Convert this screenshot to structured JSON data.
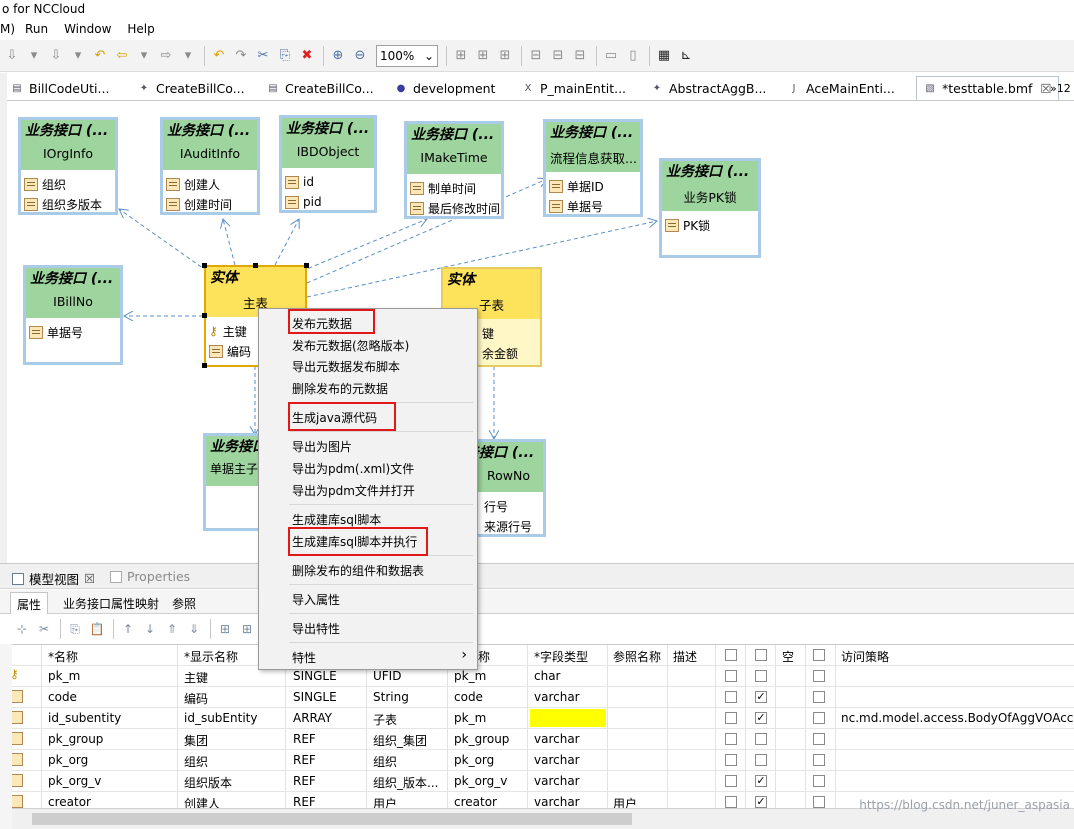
{
  "window": {
    "title": "o for NCCloud"
  },
  "menu": [
    "M)",
    "Run",
    "Window",
    "Help"
  ],
  "toolbar": {
    "zoom": "100%"
  },
  "editor_tabs": [
    {
      "label": "BillCodeUti..."
    },
    {
      "label": "CreateBillCo..."
    },
    {
      "label": "CreateBillCo..."
    },
    {
      "label": "development"
    },
    {
      "label": "P_mainEntit..."
    },
    {
      "label": "AbstractAggB..."
    },
    {
      "label": "AceMainEnti..."
    },
    {
      "label": "*testtable.bmf"
    },
    {
      "label": "»12"
    }
  ],
  "diagram": {
    "stereotype": "业务接口 (...",
    "entity_stereotype": "实体",
    "nodes": {
      "iorginfo": {
        "name": "IOrgInfo",
        "attrs": [
          "组织",
          "组织多版本"
        ]
      },
      "iauditinfo": {
        "name": "IAuditInfo",
        "attrs": [
          "创建人",
          "创建时间"
        ]
      },
      "ibdobject": {
        "name": "IBDObject",
        "attrs": [
          "id",
          "pid"
        ]
      },
      "imaketime": {
        "name": "IMakeTime",
        "attrs": [
          "制单时间",
          "最后修改时间"
        ]
      },
      "flowinfo": {
        "name": "流程信息获取...",
        "attrs": [
          "单据ID",
          "单据号"
        ]
      },
      "pklock": {
        "name": "业务PK锁",
        "attrs": [
          "PK锁"
        ]
      },
      "ibillno": {
        "name": "IBillNo",
        "attrs": [
          "单据号"
        ]
      },
      "main": {
        "name": "主表",
        "attrs": [
          "主键",
          "编码"
        ]
      },
      "child": {
        "name": "子表",
        "attrs": [
          "键",
          "余金额"
        ]
      },
      "billmain": {
        "name": "单据主子"
      },
      "rowno": {
        "name": "RowNo",
        "attrs": [
          "行号",
          "来源行号"
        ]
      }
    }
  },
  "context_menu": {
    "items": [
      "发布元数据",
      "发布元数据(忽略版本)",
      "导出元数据发布脚本",
      "删除发布的元数据",
      "生成java源代码",
      "导出为图片",
      "导出为pdm(.xml)文件",
      "导出为pdm文件并打开",
      "生成建库sql脚本",
      "生成建库sql脚本并执行",
      "删除发布的组件和数据表",
      "导入属性",
      "导出特性",
      "特性"
    ],
    "submenu_arrow": "›"
  },
  "bottom_panel": {
    "tabs": [
      "模型视图",
      "Properties"
    ],
    "subtabs": [
      "属性",
      "业务接口属性映射",
      "参照"
    ]
  },
  "grid": {
    "headers": [
      "*名称",
      "*显示名称",
      "名称",
      "*字段类型",
      "参照名称",
      "描述",
      "空",
      "访问策略"
    ],
    "rows": [
      {
        "name": "pk_m",
        "display": "主键",
        "kind": "SINGLE",
        "type": "UFID",
        "field": "pk_m",
        "ftype": "char",
        "ref": "",
        "c1": false,
        "c2": false,
        "c3": false,
        "policy": ""
      },
      {
        "name": "code",
        "display": "编码",
        "kind": "SINGLE",
        "type": "String",
        "field": "code",
        "ftype": "varchar",
        "ref": "",
        "c1": false,
        "c2": true,
        "c3": false,
        "policy": ""
      },
      {
        "name": "id_subentity",
        "display": "id_subEntity",
        "kind": "ARRAY",
        "type": "子表",
        "field": "pk_m",
        "ftype": "",
        "ref": "",
        "c1": false,
        "c2": true,
        "c3": false,
        "policy": "nc.md.model.access.BodyOfAggVOAcce"
      },
      {
        "name": "pk_group",
        "display": "集团",
        "kind": "REF",
        "type": "组织_集团",
        "field": "pk_group",
        "ftype": "varchar",
        "ref": "",
        "c1": false,
        "c2": false,
        "c3": false,
        "policy": ""
      },
      {
        "name": "pk_org",
        "display": "组织",
        "kind": "REF",
        "type": "组织",
        "field": "pk_org",
        "ftype": "varchar",
        "ref": "",
        "c1": false,
        "c2": false,
        "c3": false,
        "policy": ""
      },
      {
        "name": "pk_org_v",
        "display": "组织版本",
        "kind": "REF",
        "type": "组织_版本...",
        "field": "pk_org_v",
        "ftype": "varchar",
        "ref": "",
        "c1": false,
        "c2": true,
        "c3": false,
        "policy": ""
      },
      {
        "name": "creator",
        "display": "创建人",
        "kind": "REF",
        "type": "用户",
        "field": "creator",
        "ftype": "varchar",
        "ref": "用户",
        "c1": false,
        "c2": true,
        "c3": false,
        "policy": ""
      }
    ]
  },
  "watermark": "https://blog.csdn.net/juner_aspasia"
}
